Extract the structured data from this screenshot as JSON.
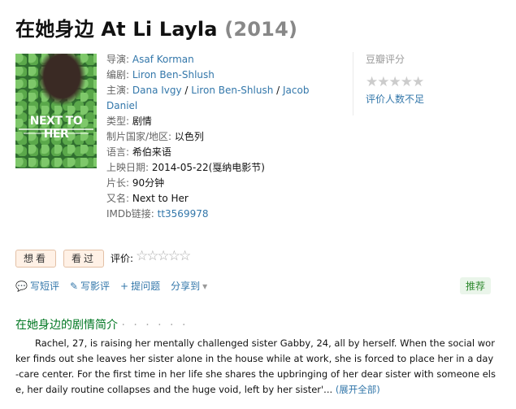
{
  "title": {
    "main": "在她身边 At Li Layla",
    "year": "(2014)"
  },
  "poster": {
    "text": "NEXT TO HER"
  },
  "info": [
    {
      "label": "导演",
      "sep": ": ",
      "links": [
        "Asaf Korman"
      ]
    },
    {
      "label": "编剧",
      "sep": ": ",
      "links": [
        "Liron Ben-Shlush"
      ]
    },
    {
      "label": "主演",
      "sep": ": ",
      "links": [
        "Dana Ivgy",
        "Liron Ben-Shlush",
        "Jacob Daniel"
      ]
    },
    {
      "label": "类型",
      "sep": ": ",
      "value": "剧情"
    },
    {
      "label": "制片国家/地区",
      "sep": ": ",
      "value": "以色列"
    },
    {
      "label": "语言",
      "sep": ": ",
      "value": "希伯来语"
    },
    {
      "label": "上映日期",
      "sep": ": ",
      "value": "2014-05-22(戛纳电影节)"
    },
    {
      "label": "片长",
      "sep": ": ",
      "value": "90分钟"
    },
    {
      "label": "又名",
      "sep": ": ",
      "value": "Next to Her"
    },
    {
      "label": "IMDb链接",
      "sep": ": ",
      "links": [
        "tt3569978"
      ]
    }
  ],
  "rating": {
    "header": "豆瓣评分",
    "stars": "★★★★★",
    "no_votes": "评价人数不足"
  },
  "buttons": {
    "want": "想看",
    "seen": "看过"
  },
  "user_rating": {
    "label": "评价:",
    "stars": "☆☆☆☆☆"
  },
  "actions": [
    {
      "icon": "comment-icon",
      "glyph": "💬",
      "label": "写短评"
    },
    {
      "icon": "pencil-icon",
      "glyph": "✎",
      "label": "写影评"
    },
    {
      "icon": "plus-icon",
      "glyph": "+",
      "label": "提问题"
    },
    {
      "icon": "",
      "glyph": "",
      "label": "分享到"
    }
  ],
  "share_arrow": "▾",
  "recommend": "推荐",
  "summary": {
    "title": "在她身边的剧情简介",
    "dots": "· · · · · ·",
    "text": "Rachel, 27, is raising her mentally challenged sister Gabby, 24, all by herself. When the social worker finds out she leaves her sister alone in the house while at work, she is forced to place her in a day-care center. For the first time in her life she shares the upbringing of her dear sister with someone else, her daily routine collapses and the huge void, left by her sister'...",
    "expand": "(展开全部)"
  },
  "colors": {
    "link": "#3377aa",
    "section_title": "#007722",
    "button_bg": "#fff1e6",
    "recommend_bg": "#eaf5ea"
  }
}
